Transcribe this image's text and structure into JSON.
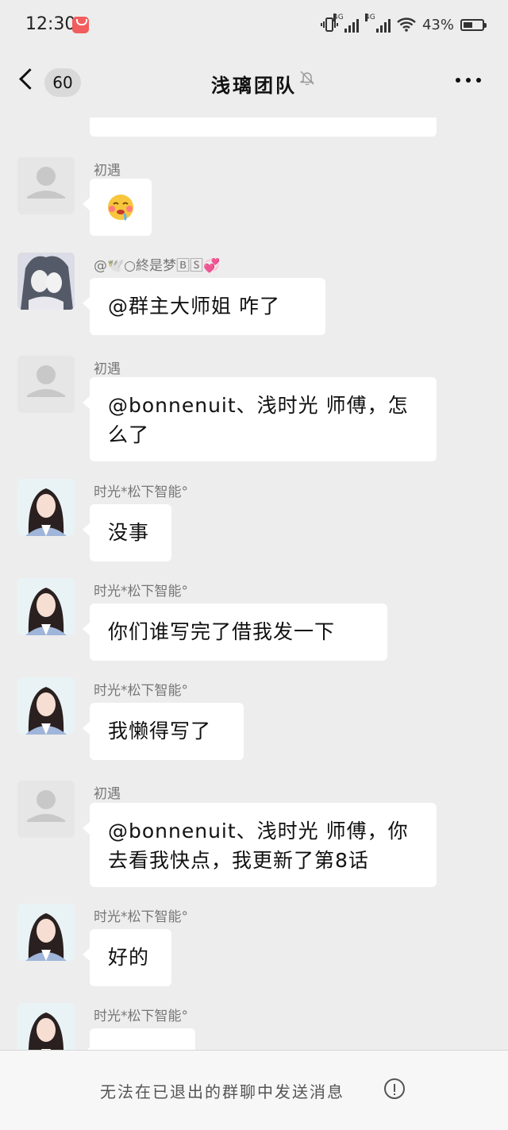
{
  "status": {
    "time": "12:30",
    "network_1": "4G",
    "network_2": "4G",
    "battery": "43%",
    "battery_level": 0.43
  },
  "nav": {
    "unread_count": "60",
    "title": "浅璃团队"
  },
  "messages": [
    {
      "sender": "",
      "text": "",
      "avatar": "default"
    },
    {
      "sender": "初遇",
      "text": "🤤",
      "avatar": "default"
    },
    {
      "sender": "@🕊️○終是梦🄱🅂💞",
      "text": "@群主大师姐  咋了",
      "avatar": "anime"
    },
    {
      "sender": "初遇",
      "text": "@bonnenuit、浅时光  师傅，怎么了",
      "avatar": "default"
    },
    {
      "sender": "时光*松下智能°",
      "text": "没事",
      "avatar": "girl"
    },
    {
      "sender": "时光*松下智能°",
      "text": "你们谁写完了借我发一下",
      "avatar": "girl"
    },
    {
      "sender": "时光*松下智能°",
      "text": "我懒得写了",
      "avatar": "girl"
    },
    {
      "sender": "初遇",
      "text": "@bonnenuit、浅时光  师傅，你去看我快点，我更新了第8话",
      "avatar": "default"
    },
    {
      "sender": "时光*松下智能°",
      "text": "好的",
      "avatar": "girl"
    },
    {
      "sender": "时光*松下智能°",
      "text": "",
      "avatar": "girl"
    }
  ],
  "footer": {
    "notice": "无法在已退出的群聊中发送消息"
  }
}
